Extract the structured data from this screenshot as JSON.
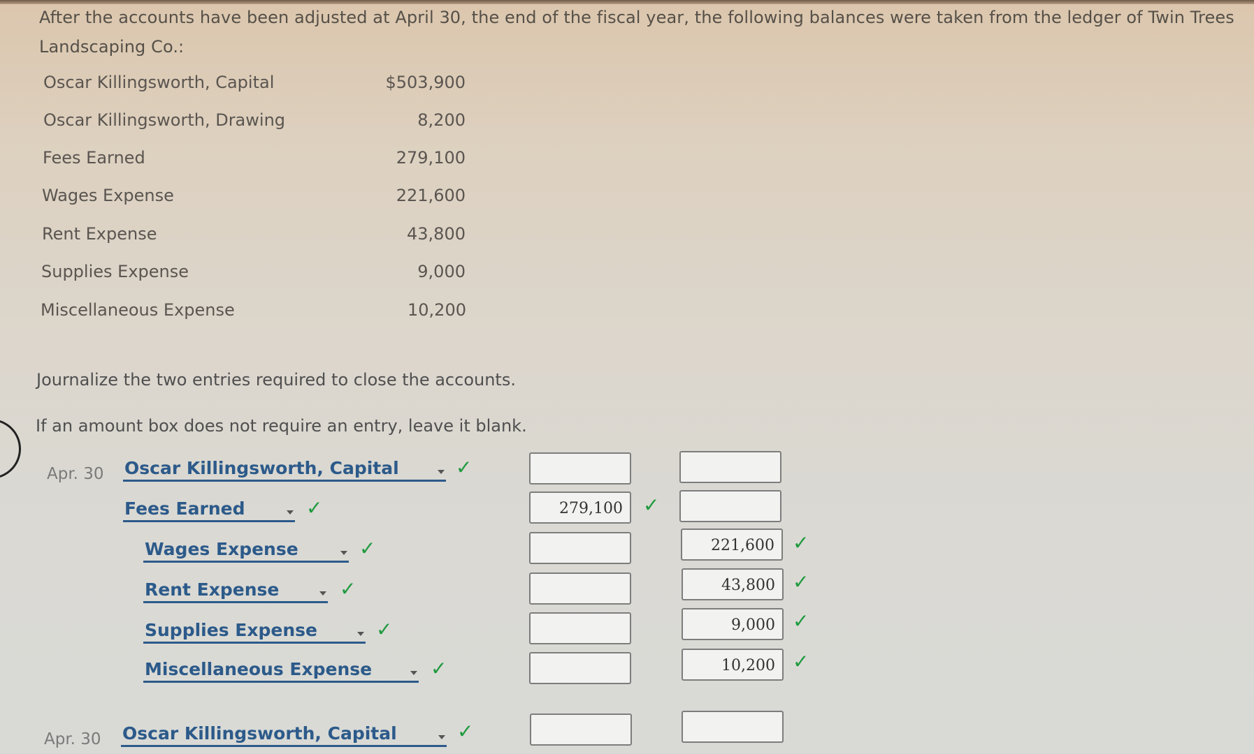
{
  "problem": {
    "intro": "After the accounts have been adjusted at April 30, the end of the fiscal year, the following balances were taken from the ledger of Twin Trees Landscaping Co.:",
    "balances": [
      {
        "account": "Oscar Killingsworth, Capital",
        "amount": "$503,900"
      },
      {
        "account": "Oscar Killingsworth, Drawing",
        "amount": "8,200"
      },
      {
        "account": "Fees Earned",
        "amount": "279,100"
      },
      {
        "account": "Wages Expense",
        "amount": "221,600"
      },
      {
        "account": "Rent Expense",
        "amount": "43,800"
      },
      {
        "account": "Supplies Expense",
        "amount": "9,000"
      },
      {
        "account": "Miscellaneous Expense",
        "amount": "10,200"
      }
    ],
    "instruction1": "Journalize the two entries required to close the accounts.",
    "instruction2": "If an amount box does not require an entry, leave it blank."
  },
  "journal": {
    "check_glyph": "✓",
    "entries": [
      {
        "date": "Apr. 30",
        "lines": [
          {
            "account": "Oscar Killingsworth, Capital",
            "debit": "",
            "credit": "",
            "account_correct": true,
            "debit_correct": false,
            "credit_correct": false
          },
          {
            "account": "Fees Earned",
            "debit": "279,100",
            "credit": "",
            "account_correct": true,
            "debit_correct": true,
            "credit_correct": false
          },
          {
            "account": "Wages Expense",
            "debit": "",
            "credit": "221,600",
            "account_correct": true,
            "debit_correct": false,
            "credit_correct": true
          },
          {
            "account": "Rent Expense",
            "debit": "",
            "credit": "43,800",
            "account_correct": true,
            "debit_correct": false,
            "credit_correct": true
          },
          {
            "account": "Supplies Expense",
            "debit": "",
            "credit": "9,000",
            "account_correct": true,
            "debit_correct": false,
            "credit_correct": true
          },
          {
            "account": "Miscellaneous Expense",
            "debit": "",
            "credit": "10,200",
            "account_correct": true,
            "debit_correct": false,
            "credit_correct": true
          }
        ]
      },
      {
        "date": "Apr. 30",
        "lines": [
          {
            "account": "Oscar Killingsworth, Capital",
            "debit": "",
            "credit": "",
            "account_correct": true,
            "debit_correct": false,
            "credit_correct": false
          }
        ]
      }
    ]
  },
  "colors": {
    "link_blue": "#2c5a8a",
    "check_green": "#1f9a3e"
  }
}
